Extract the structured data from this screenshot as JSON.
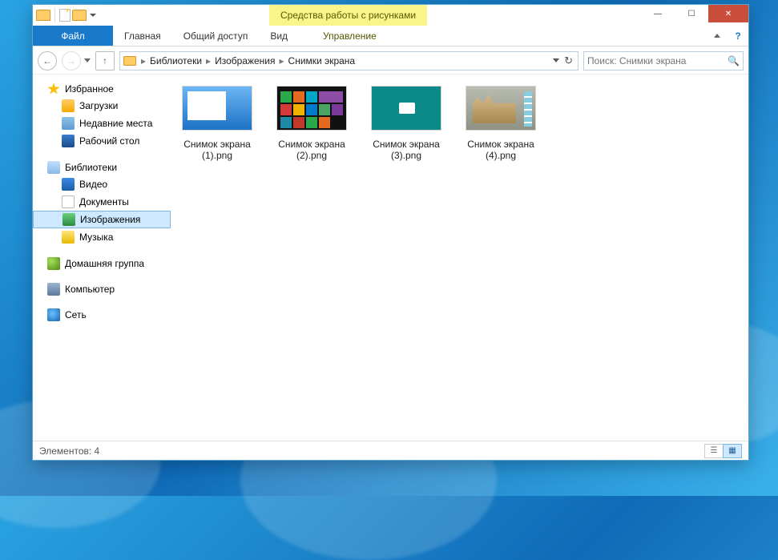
{
  "window": {
    "context_tab_title": "Средства работы с рисунками",
    "title": "Снимки экрана"
  },
  "ribbon": {
    "file": "Файл",
    "home": "Главная",
    "share": "Общий доступ",
    "view": "Вид",
    "manage": "Управление"
  },
  "breadcrumb": {
    "p1": "Библиотеки",
    "p2": "Изображения",
    "p3": "Снимки экрана"
  },
  "search": {
    "placeholder": "Поиск: Снимки экрана"
  },
  "nav": {
    "favorites": "Избранное",
    "downloads": "Загрузки",
    "recent": "Недавние места",
    "desktop": "Рабочий стол",
    "libraries": "Библиотеки",
    "videos": "Видео",
    "documents": "Документы",
    "pictures": "Изображения",
    "music": "Музыка",
    "homegroup": "Домашняя группа",
    "computer": "Компьютер",
    "network": "Сеть"
  },
  "files": [
    {
      "name": "Снимок экрана (1).png"
    },
    {
      "name": "Снимок экрана (2).png"
    },
    {
      "name": "Снимок экрана (3).png"
    },
    {
      "name": "Снимок экрана (4).png"
    }
  ],
  "status": {
    "label": "Элементов: 4"
  }
}
